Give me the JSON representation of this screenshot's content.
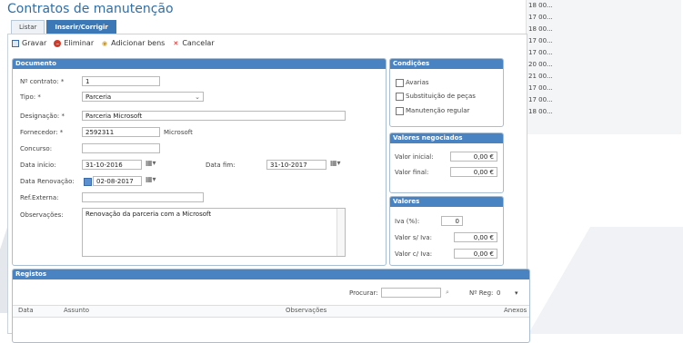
{
  "page_title": "Contratos de manutenção",
  "tabs": [
    {
      "label": "Listar"
    },
    {
      "label": "Inserir/Corrigir"
    }
  ],
  "toolbar": {
    "save": "Gravar",
    "delete": "Eliminar",
    "add_goods": "Adicionar bens",
    "cancel": "Cancelar"
  },
  "documento": {
    "header": "Documento",
    "contract_no_label": "Nº contrato: *",
    "contract_no": "1",
    "tipo_label": "Tipo: *",
    "tipo": "Parceria",
    "designacao_label": "Designação: *",
    "designacao": "Parceria Microsoft",
    "fornecedor_label": "Fornecedor: *",
    "fornecedor_code": "2592311",
    "fornecedor_name": "Microsoft",
    "concurso_label": "Concurso:",
    "concurso": "",
    "data_inicio_label": "Data início:",
    "data_inicio": "31-10-2016",
    "data_fim_label": "Data fim:",
    "data_fim": "31-10-2017",
    "data_renovacao_label": "Data Renovação:",
    "data_renovacao": "02-08-2017",
    "ref_externa_label": "Ref.Externa:",
    "ref_externa": "",
    "observacoes_label": "Observações:",
    "observacoes": "Renovação da parceria com a Microsoft"
  },
  "condicoes": {
    "header": "Condições",
    "items": [
      {
        "label": "Avarias",
        "checked": false
      },
      {
        "label": "Substituição de peças",
        "checked": false
      },
      {
        "label": "Manutenção regular",
        "checked": false
      }
    ]
  },
  "valores_negociados": {
    "header": "Valores negociados",
    "inicial_label": "Valor inicial:",
    "inicial": "0,00 €",
    "final_label": "Valor final:",
    "final": "0,00 €"
  },
  "valores": {
    "header": "Valores",
    "iva_label": "Iva (%):",
    "iva": "0",
    "sem_iva_label": "Valor s/ Iva:",
    "sem_iva": "0,00 €",
    "com_iva_label": "Valor c/ Iva:",
    "com_iva": "0,00 €"
  },
  "registos": {
    "header": "Registos",
    "search_label": "Procurar:",
    "search_value": "",
    "nreg_label": "Nº Reg:",
    "nreg_value": "0",
    "columns": [
      "Data",
      "Assunto",
      "Observações",
      "Anexos"
    ]
  },
  "side_list": [
    "18 00...",
    "17 00...",
    "18 00...",
    "17 00...",
    "17 00...",
    "20 00...",
    "21 00...",
    "17 00...",
    "17 00...",
    "18 00..."
  ]
}
